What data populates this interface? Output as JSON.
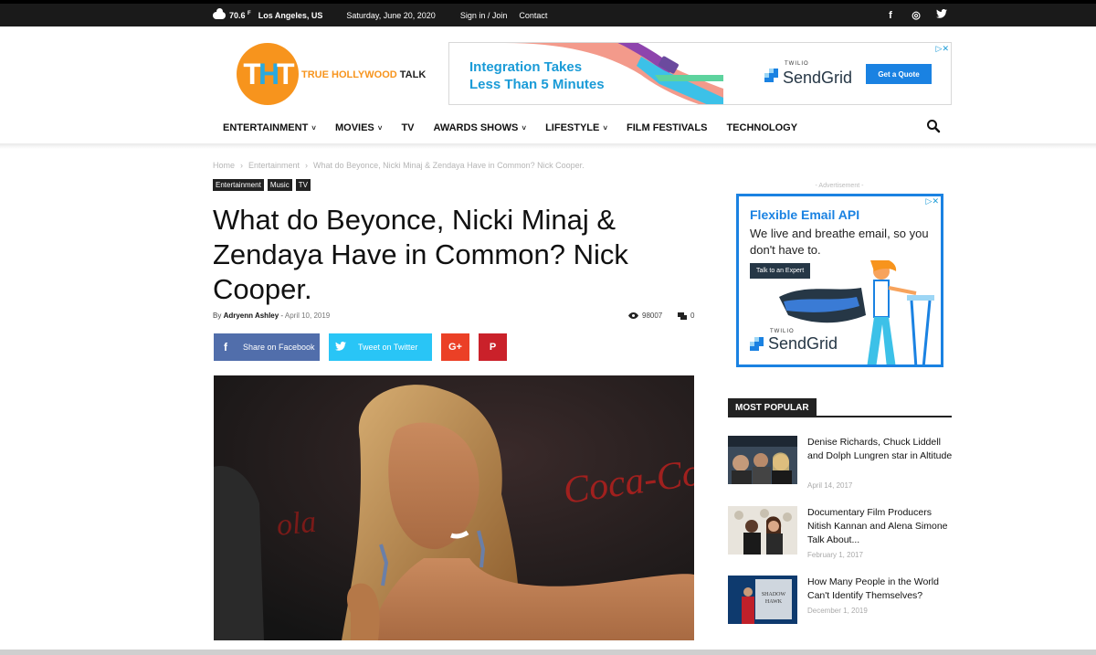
{
  "topbar": {
    "weather_icon": "cloud-icon",
    "temp": "70.6",
    "temp_unit": "F",
    "location": "Los Angeles, US",
    "date": "Saturday, June 20, 2020",
    "signin": "Sign in / Join",
    "contact": "Contact",
    "social": [
      "f",
      "◎",
      "✴"
    ]
  },
  "logo": {
    "letters_t1": "T",
    "letters_h": "H",
    "letters_t2": "T",
    "text_part1": "TRUE HOLLYWOOD",
    "text_part2": "TALK"
  },
  "ad_top": {
    "line1": "Integration Takes",
    "line2": "Less Than 5 Minutes",
    "brand_small": "TWILIO",
    "brand_name": "SendGrid",
    "cta": "Get a Quote",
    "adchoice": "▷✕"
  },
  "nav": {
    "items": [
      {
        "label": "ENTERTAINMENT",
        "dropdown": true
      },
      {
        "label": "MOVIES",
        "dropdown": true
      },
      {
        "label": "TV",
        "dropdown": false
      },
      {
        "label": "AWARDS SHOWS",
        "dropdown": true
      },
      {
        "label": "LIFESTYLE",
        "dropdown": true
      },
      {
        "label": "FILM FESTIVALS",
        "dropdown": false
      },
      {
        "label": "TECHNOLOGY",
        "dropdown": false
      }
    ],
    "chevron": "˅"
  },
  "breadcrumb": {
    "home": "Home",
    "sep": "›",
    "category": "Entertainment",
    "current": "What do Beyonce, Nicki Minaj & Zendaya Have in Common? Nick Cooper."
  },
  "tags": [
    "Entertainment",
    "Music",
    "TV"
  ],
  "article": {
    "title": "What do Beyonce, Nicki Minaj & Zendaya Have in Common? Nick Cooper.",
    "by": "By",
    "author": "Adryenn Ashley",
    "dash": "-",
    "date": "April 10, 2019",
    "views": "98007",
    "comments": "0"
  },
  "share": {
    "facebook": "Share on Facebook",
    "twitter": "Tweet on Twitter",
    "gplus": "G+",
    "pinterest": "P"
  },
  "sidebar": {
    "ad_label": "- Advertisement -",
    "ad": {
      "headline": "Flexible Email API",
      "body": "We live and breathe email, so you don't have to.",
      "button": "Talk to an Expert",
      "brand_small": "TWILIO",
      "brand_name": "SendGrid",
      "adchoice": "▷✕"
    },
    "most_popular": "MOST POPULAR",
    "posts": [
      {
        "title": "Denise Richards, Chuck Liddell and Dolph Lungren star in Altitude",
        "date": "April 14, 2017"
      },
      {
        "title": "Documentary Film Producers Nitish Kannan and Alena Simone Talk About...",
        "date": "February 1, 2017"
      },
      {
        "title": "How Many People in the World Can't Identify Themselves?",
        "date": "December 1, 2019"
      }
    ]
  },
  "colors": {
    "accent_orange": "#f7941d",
    "accent_blue": "#1a82e2",
    "facebook": "#516eab",
    "twitter": "#29c5f6",
    "gplus": "#eb4026",
    "pinterest": "#ca212a"
  }
}
